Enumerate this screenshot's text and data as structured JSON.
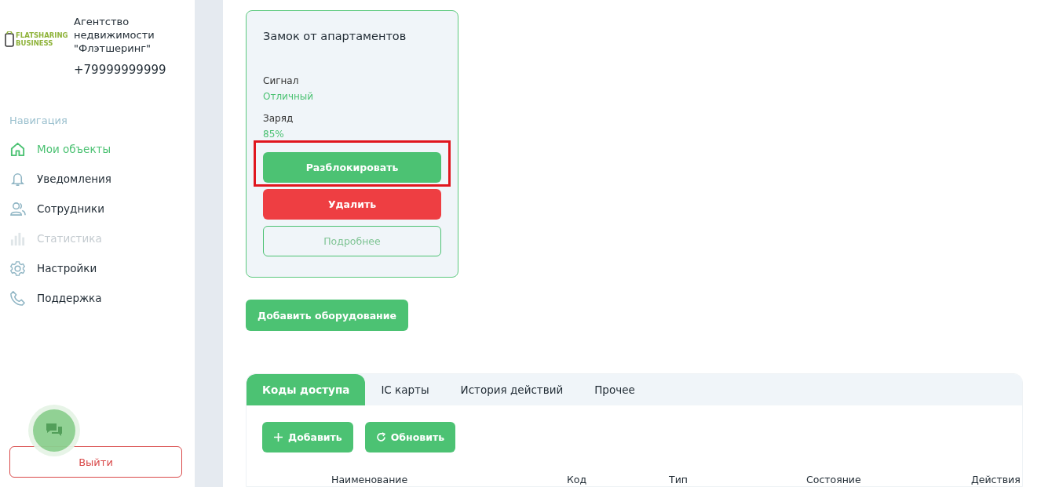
{
  "company": {
    "logo_line1": "FLATSHARING",
    "logo_line2": "BUSINESS",
    "name": "Агентство недвижимости \"Флэтшеринг\"",
    "phone": "+79999999999"
  },
  "navigation": {
    "title": "Навигация",
    "items": [
      {
        "label": "Мои объекты",
        "selected": true,
        "disabled": false
      },
      {
        "label": "Уведомления",
        "selected": false,
        "disabled": false
      },
      {
        "label": "Сотрудники",
        "selected": false,
        "disabled": false
      },
      {
        "label": "Статистика",
        "selected": false,
        "disabled": true
      },
      {
        "label": "Настройки",
        "selected": false,
        "disabled": false
      },
      {
        "label": "Поддержка",
        "selected": false,
        "disabled": false
      }
    ]
  },
  "logout": "Выйти",
  "device": {
    "title": "Замок от апартаментов",
    "fields": [
      {
        "label": "Сигнал",
        "value": "Отличный"
      },
      {
        "label": "Заряд",
        "value": "85%"
      }
    ],
    "actions": [
      {
        "label": "Разблокировать",
        "kind": "primary",
        "highlighted": true
      },
      {
        "label": "Удалить",
        "kind": "danger"
      },
      {
        "label": "Подробнее",
        "kind": "outline"
      }
    ]
  },
  "add_equipment": "Добавить оборудование",
  "tabs": [
    {
      "label": "Коды доступа",
      "selected": true
    },
    {
      "label": "IC карты",
      "selected": false
    },
    {
      "label": "История действий",
      "selected": false
    },
    {
      "label": "Прочее",
      "selected": false
    }
  ],
  "toolbar": [
    {
      "label": "Добавить"
    },
    {
      "label": "Обновить"
    }
  ],
  "table": {
    "columns": [
      "Наименование",
      "Код",
      "Тип",
      "Состояние",
      "Действия"
    ]
  }
}
